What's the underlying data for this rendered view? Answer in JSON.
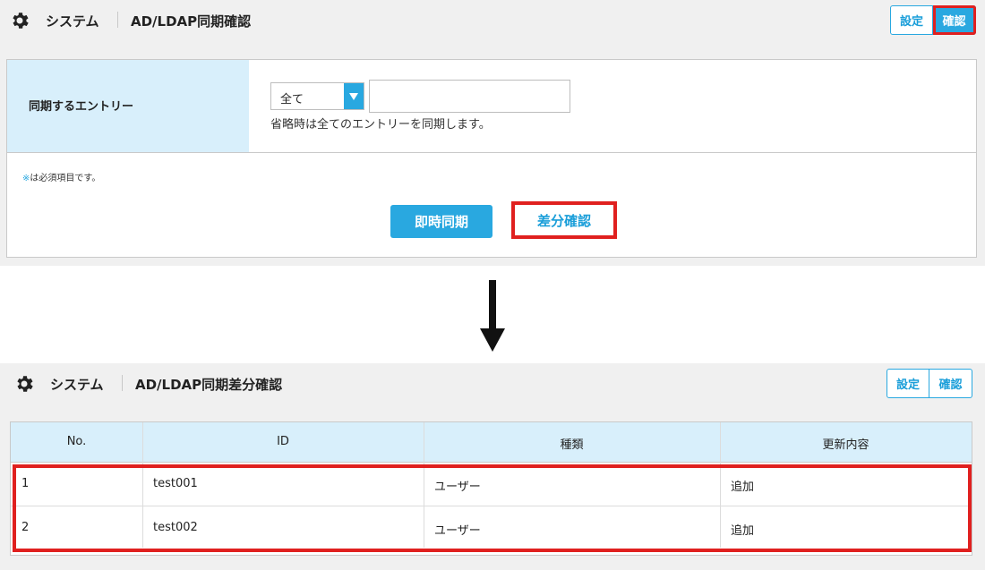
{
  "top": {
    "header": {
      "section": "システム",
      "page_title": "AD/LDAP同期確認",
      "buttons": {
        "settings": "設定",
        "confirm": "確認"
      }
    },
    "form": {
      "entry_label": "同期するエントリー",
      "select_value": "全て",
      "text_value": "",
      "hint": "省略時は全てのエントリーを同期します。",
      "required_mark": "※",
      "required_note": "は必須項目です。",
      "sync_button": "即時同期",
      "diff_button": "差分確認"
    }
  },
  "bottom": {
    "header": {
      "section": "システム",
      "page_title": "AD/LDAP同期差分確認",
      "buttons": {
        "settings": "設定",
        "confirm": "確認"
      }
    },
    "table": {
      "columns": [
        "No.",
        "ID",
        "種類",
        "更新内容"
      ],
      "rows": [
        {
          "no": "1",
          "id": "test001",
          "type": "ユーザー",
          "change": "追加"
        },
        {
          "no": "2",
          "id": "test002",
          "type": "ユーザー",
          "change": "追加"
        }
      ]
    }
  },
  "colors": {
    "accent": "#29a8e0",
    "highlight": "#e0201f",
    "label_bg": "#d8effb",
    "panel_bg": "#f0f0f0"
  },
  "icons": {
    "settings": "gear-icon",
    "transition": "arrow-down-icon",
    "dropdown": "triangle-down-icon"
  }
}
